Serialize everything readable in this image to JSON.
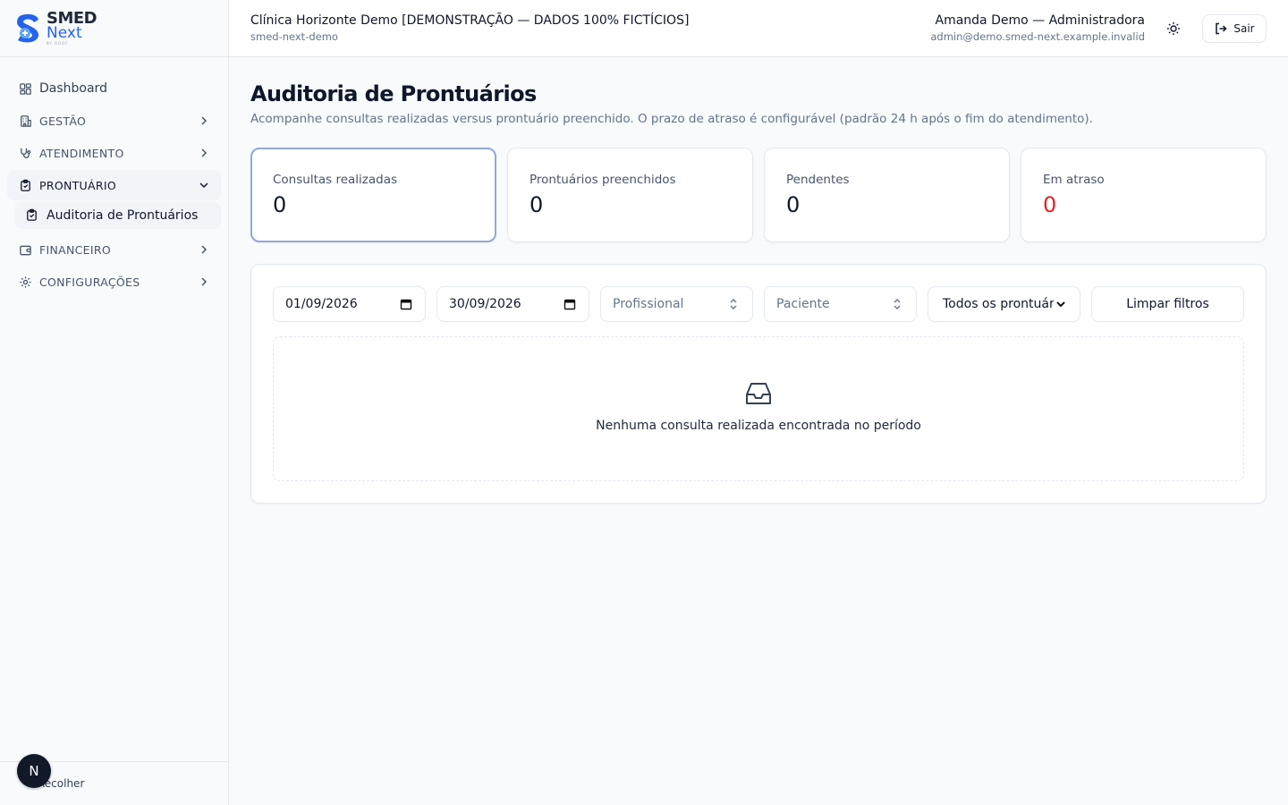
{
  "brand": {
    "name": "SMED",
    "product": "Next",
    "tagline": "BY ROOF"
  },
  "sidebar": {
    "items": [
      {
        "label": "Dashboard",
        "icon": "dashboard-grid-icon"
      },
      {
        "label": "GESTÃO",
        "icon": "building-icon"
      },
      {
        "label": "ATENDIMENTO",
        "icon": "stethoscope-icon"
      },
      {
        "label": "PRONTUÁRIO",
        "icon": "clipboard-icon",
        "expanded": true
      },
      {
        "label": "FINANCEIRO",
        "icon": "wallet-icon"
      },
      {
        "label": "CONFIGURAÇÕES",
        "icon": "gear-icon"
      }
    ],
    "subitem": {
      "label": "Auditoria de Prontuários",
      "icon": "clipboard-check-icon"
    },
    "collapse_label": "Recolher",
    "avatar_letter": "N"
  },
  "header": {
    "clinic_name": "Clínica Horizonte Demo [DEMONSTRAÇÃO — DADOS 100% FICTÍCIOS]",
    "clinic_slug": "smed-next-demo",
    "user_name": "Amanda Demo — Administradora",
    "user_email": "admin@demo.smed-next.example.invalid",
    "logout_label": "Sair"
  },
  "page": {
    "title": "Auditoria de Prontuários",
    "description": "Acompanhe consultas realizadas versus prontuário preenchido. O prazo de atraso é configurável (padrão 24 h após o fim do atendimento)."
  },
  "stats": [
    {
      "label": "Consultas realizadas",
      "value": "0"
    },
    {
      "label": "Prontuários preenchidos",
      "value": "0"
    },
    {
      "label": "Pendentes",
      "value": "0"
    },
    {
      "label": "Em atraso",
      "value": "0"
    }
  ],
  "filters": {
    "date_start": "01/09/2026",
    "date_end": "30/09/2026",
    "professional_placeholder": "Profissional",
    "patient_placeholder": "Paciente",
    "status_selected": "Todos os prontuários",
    "clear_label": "Limpar filtros"
  },
  "empty_state": {
    "message": "Nenhuma consulta realizada encontrada no período"
  },
  "colors": {
    "accent": "#2563eb",
    "danger": "#dc2626",
    "active_border": "#93a8d6"
  }
}
